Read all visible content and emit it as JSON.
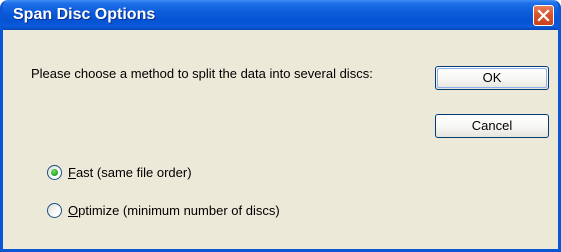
{
  "window": {
    "title": "Span Disc Options",
    "close_icon": "close-icon"
  },
  "message": "Please choose a method to split the data into several discs:",
  "buttons": {
    "ok_label": "OK",
    "cancel_label": "Cancel"
  },
  "options": [
    {
      "accel": "F",
      "rest": "ast (same file order)",
      "label": "Fast (same file order)",
      "selected": true
    },
    {
      "accel": "O",
      "rest": "ptimize (minimum number of discs)",
      "label": "Optimize (minimum number of discs)",
      "selected": false
    }
  ],
  "colors": {
    "titlebar": "#0a5ad9",
    "dialog_bg": "#ece9d8",
    "close_button": "#d9542c",
    "radio_dot": "#2bab26"
  }
}
